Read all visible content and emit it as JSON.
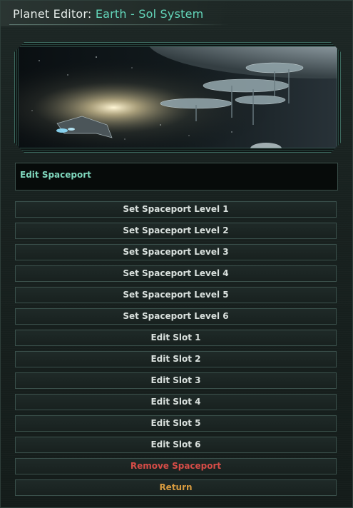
{
  "window": {
    "title_prefix": "Planet Editor:",
    "title_planet": "Earth - Sol System"
  },
  "banner": {
    "icon": "space-station-artwork"
  },
  "section": {
    "header": "Edit Spaceport"
  },
  "buttons": [
    {
      "label": "Set Spaceport Level 1"
    },
    {
      "label": "Set Spaceport Level 2"
    },
    {
      "label": "Set Spaceport Level 3"
    },
    {
      "label": "Set Spaceport Level 4"
    },
    {
      "label": "Set Spaceport Level 5"
    },
    {
      "label": "Set Spaceport Level 6"
    },
    {
      "label": "Edit Slot 1"
    },
    {
      "label": "Edit Slot 2"
    },
    {
      "label": "Edit Slot 3"
    },
    {
      "label": "Edit Slot 4"
    },
    {
      "label": "Edit Slot 5"
    },
    {
      "label": "Edit Slot 6"
    },
    {
      "label": "Remove Spaceport"
    },
    {
      "label": "Return"
    }
  ],
  "colors": {
    "accent": "#63d6ba",
    "danger": "#d64c47",
    "return": "#d79a3f",
    "frame": "#3d6a5f"
  }
}
